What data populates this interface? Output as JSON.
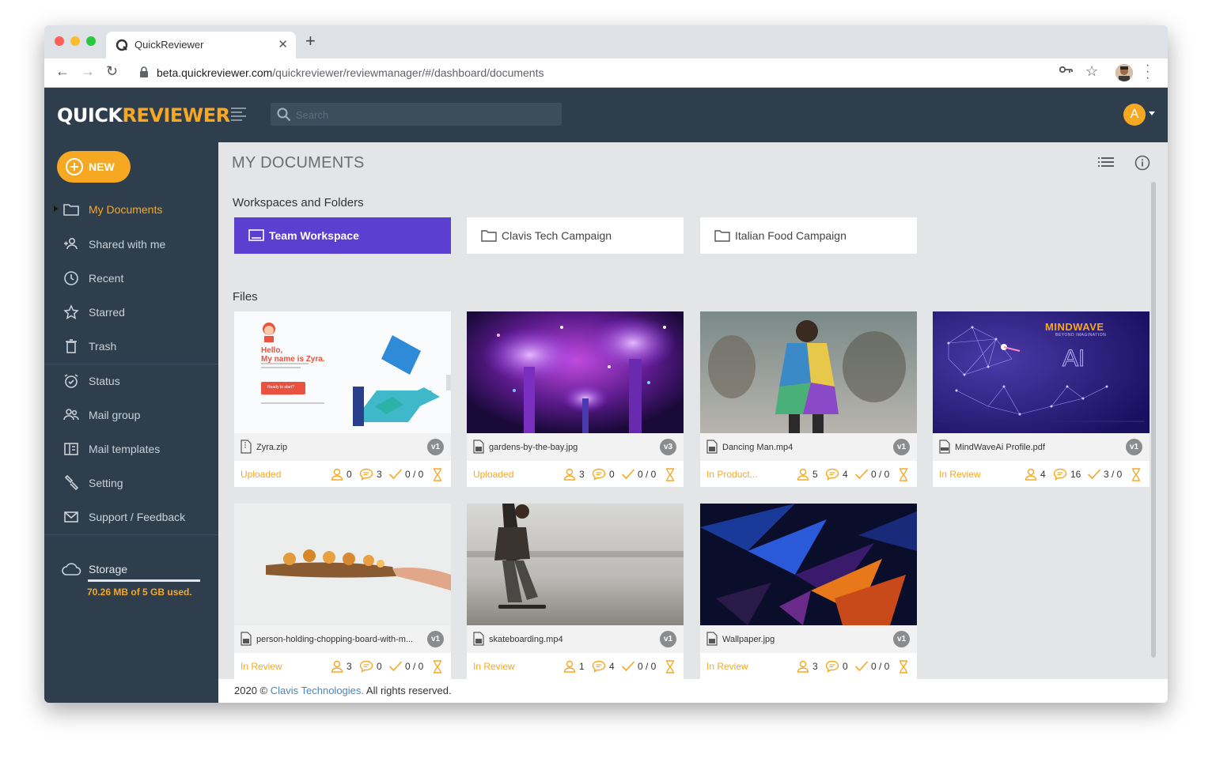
{
  "browser": {
    "tab_title": "QuickReviewer",
    "url_host": "beta.quickreviewer.com",
    "url_path": "/quickreviewer/reviewmanager/#/dashboard/documents"
  },
  "header": {
    "logo_part1": "QUICK",
    "logo_part2": "REVIEWER",
    "search_placeholder": "Search",
    "avatar_letter": "A"
  },
  "sidebar": {
    "new_label": "NEW",
    "items": [
      {
        "label": "My Documents",
        "icon": "folder-icon"
      },
      {
        "label": "Shared with me",
        "icon": "shared-users-icon"
      },
      {
        "label": "Recent",
        "icon": "clock-icon"
      },
      {
        "label": "Starred",
        "icon": "star-icon"
      },
      {
        "label": "Trash",
        "icon": "trash-icon"
      },
      {
        "label": "Status",
        "icon": "alarm-icon"
      },
      {
        "label": "Mail group",
        "icon": "group-icon"
      },
      {
        "label": "Mail templates",
        "icon": "template-icon"
      },
      {
        "label": "Setting",
        "icon": "wrench-icon"
      },
      {
        "label": "Support / Feedback",
        "icon": "mail-icon"
      }
    ],
    "storage_label": "Storage",
    "storage_used": "70.26 MB of 5 GB used.",
    "storage_fraction": 0.014
  },
  "main": {
    "title": "MY DOCUMENTS",
    "workspaces_title": "Workspaces and Folders",
    "folders": [
      {
        "label": "Team Workspace"
      },
      {
        "label": "Clavis Tech Campaign"
      },
      {
        "label": "Italian Food Campaign"
      }
    ],
    "files_title": "Files",
    "files": [
      {
        "name": "Zyra.zip",
        "version": "v1",
        "status": "Uploaded",
        "users": "0",
        "comments": "3",
        "approvals": "0 / 0"
      },
      {
        "name": "gardens-by-the-bay.jpg",
        "version": "v3",
        "status": "Uploaded",
        "users": "3",
        "comments": "0",
        "approvals": "0 / 0"
      },
      {
        "name": "Dancing Man.mp4",
        "version": "v1",
        "status": "In Product...",
        "users": "5",
        "comments": "4",
        "approvals": "0 / 0"
      },
      {
        "name": "MindWaveAi Profile.pdf",
        "version": "v1",
        "status": "In Review",
        "users": "4",
        "comments": "16",
        "approvals": "3 / 0"
      },
      {
        "name": "person-holding-chopping-board-with-m...",
        "version": "v1",
        "status": "In Review",
        "users": "3",
        "comments": "0",
        "approvals": "0 / 0"
      },
      {
        "name": "skateboarding.mp4",
        "version": "v1",
        "status": "In Review",
        "users": "1",
        "comments": "4",
        "approvals": "0 / 0"
      },
      {
        "name": "Wallpaper.jpg",
        "version": "v1",
        "status": "In Review",
        "users": "3",
        "comments": "0",
        "approvals": "0 / 0"
      }
    ],
    "zyra_thumb": {
      "greeting": "Hello,",
      "name_line": "My name is Zyra.",
      "button": "Ready to start?"
    },
    "mindwave_thumb": {
      "brand": "MINDWAVE",
      "tagline": "BEYOND IMAGINATION",
      "ai": "AI"
    }
  },
  "footer": {
    "prefix": "2020 © ",
    "company": "Clavis Technologies.",
    "suffix": " All rights reserved."
  },
  "colors": {
    "accent": "#f7a823",
    "sidebar_bg": "#2f3e4d",
    "workspace_active": "#5b3fd1"
  }
}
